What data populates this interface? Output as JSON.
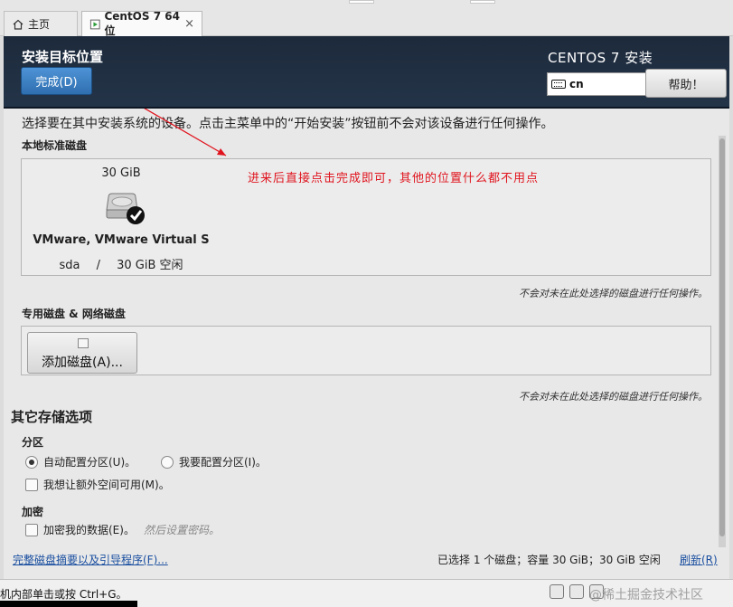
{
  "tabs": {
    "home_label": "主页",
    "vm_label": "CentOS 7 64 位",
    "close_symbol": "×"
  },
  "header": {
    "title": "安装目标位置",
    "done_button": "完成(D)",
    "product": "CENTOS 7 安装",
    "keyboard_layout": "cn",
    "help_button": "帮助！"
  },
  "main": {
    "intro": "选择要在其中安装系统的设备。点击主菜单中的“开始安装”按钮前不会对该设备进行任何操作。",
    "local_disks_label": "本地标准磁盘",
    "disk": {
      "size": "30 GiB",
      "name": "VMware, VMware Virtual S",
      "device": "sda",
      "separator": "/",
      "free": "30 GiB 空闲",
      "selected": true
    },
    "local_note": "不会对未在此处选择的磁盘进行任何操作。",
    "special_label": "专用磁盘 & 网络磁盘",
    "add_disk_button": "添加磁盘(A)...",
    "special_note": "不会对未在此处选择的磁盘进行任何操作。",
    "other_options_title": "其它存储选项",
    "partition_label": "分区",
    "auto_partition": "自动配置分区(U)。",
    "manual_partition": "我要配置分区(I)。",
    "extra_space": "我想让额外空间可用(M)。",
    "encryption_label": "加密",
    "encrypt_data": "加密我的数据(E)。",
    "encrypt_hint": "然后设置密码。",
    "summary_link": "完整磁盘摘要以及引导程序(F)...",
    "selection_summary": "已选择 1 个磁盘；容量 30 GiB；30 GiB 空闲",
    "refresh_link": "刷新(R)"
  },
  "annotation": {
    "text": "进来后直接点击完成即可，其他的位置什么都不用点",
    "color": "#e0141e"
  },
  "statusbar": {
    "message": "机内部单击或按 Ctrl+G。",
    "watermark": "@稀土掘金技术社区"
  }
}
